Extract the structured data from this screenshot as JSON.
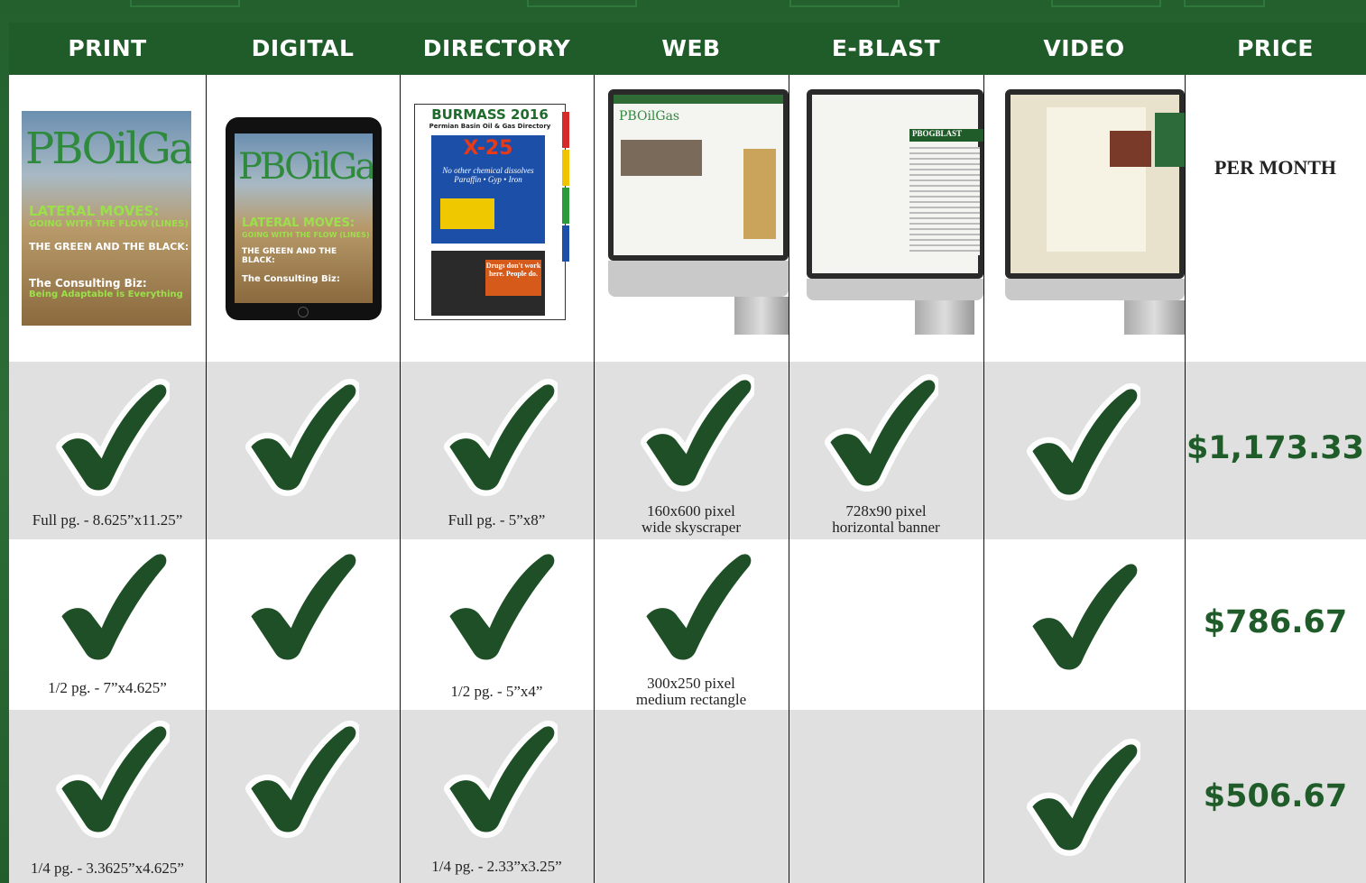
{
  "header": {
    "columns": [
      "PRINT",
      "DIGITAL",
      "DIRECTORY",
      "WEB",
      "E-BLAST",
      "VIDEO",
      "PRICE"
    ]
  },
  "images": {
    "print_cover": {
      "brand": "PBOilGas",
      "headline": "LATERAL MOVES:",
      "headline_sub": "GOING WITH THE FLOW (LINES)",
      "story1": "THE GREEN AND THE BLACK:",
      "story2": "The Consulting Biz:",
      "story2_sub": "Being Adaptable is Everything"
    },
    "directory_cover": {
      "title": "BURMASS 2016",
      "subtitle": "Permian Basin Oil & Gas Directory",
      "ad_title": "X-25",
      "ad_text": "No other chemical dissolves Paraffin • Gyp • Iron",
      "ad2_text": "Drugs don't work here. People do."
    },
    "eblast_screen": {
      "brand": "PBOGBLAST"
    }
  },
  "price_header": "PER MONTH",
  "rows": [
    {
      "price": "$1,173.33",
      "print_label": "Full pg. - 8.625”x11.25”",
      "directory_label": "Full pg. - 5”x8”",
      "web_label_1": "160x600 pixel",
      "web_label_2": "wide skyscraper",
      "eblast_label_1": "728x90 pixel",
      "eblast_label_2": "horizontal banner",
      "checks": [
        "print",
        "digital",
        "directory",
        "web",
        "eblast",
        "video"
      ]
    },
    {
      "price": "$786.67",
      "print_label": "1/2 pg. - 7”x4.625”",
      "directory_label": "1/2 pg. - 5”x4”",
      "web_label_1": "300x250 pixel",
      "web_label_2": "medium rectangle",
      "checks": [
        "print",
        "digital",
        "directory",
        "web",
        "video"
      ]
    },
    {
      "price": "$506.67",
      "print_label": "1/4 pg. - 3.3625”x4.625”",
      "directory_label": "1/4 pg. - 2.33”x3.25”",
      "checks": [
        "print",
        "digital",
        "directory",
        "video"
      ]
    }
  ],
  "colors": {
    "brand_green": "#1f5c2a",
    "row_grey": "#e0e0e0"
  }
}
